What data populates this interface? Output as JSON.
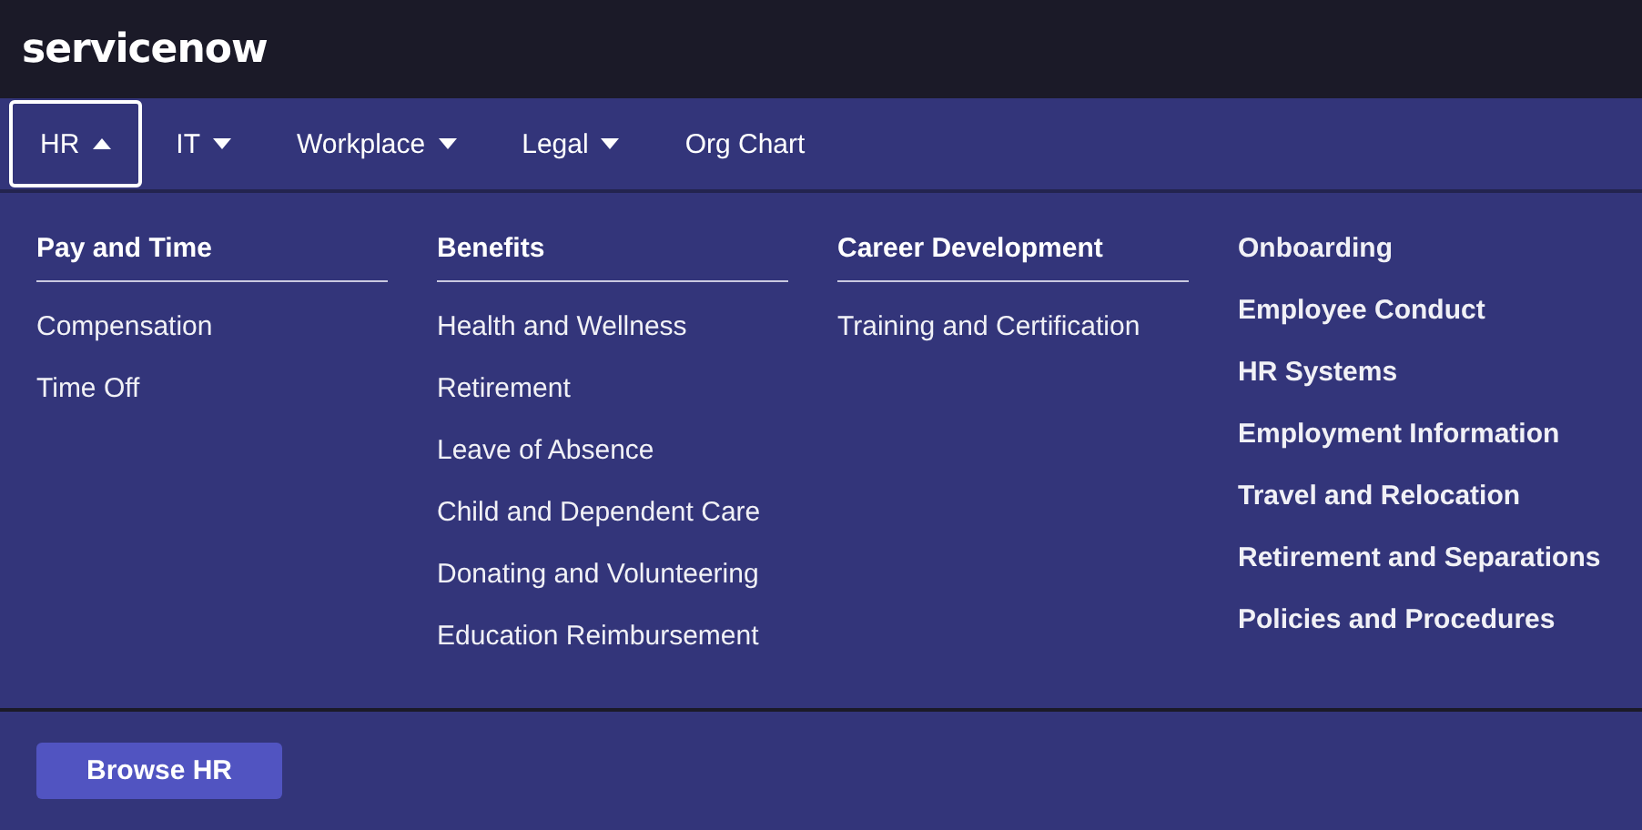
{
  "header": {
    "logo": "servicenow"
  },
  "nav": [
    {
      "label": "HR",
      "kind": "dropdown",
      "expanded": true
    },
    {
      "label": "IT",
      "kind": "dropdown",
      "expanded": false
    },
    {
      "label": "Workplace",
      "kind": "dropdown",
      "expanded": false
    },
    {
      "label": "Legal",
      "kind": "dropdown",
      "expanded": false
    },
    {
      "label": "Org Chart",
      "kind": "link",
      "expanded": false
    }
  ],
  "menu": {
    "columns": [
      {
        "kind": "group",
        "heading": "Pay and Time",
        "items": [
          "Compensation",
          "Time Off"
        ]
      },
      {
        "kind": "group",
        "heading": "Benefits",
        "items": [
          "Health and Wellness",
          "Retirement",
          "Leave of Absence",
          "Child and Dependent Care",
          "Donating and Volunteering",
          "Education Reimbursement"
        ]
      },
      {
        "kind": "group",
        "heading": "Career Development",
        "items": [
          "Training and Certification"
        ]
      },
      {
        "kind": "links",
        "items": [
          "Onboarding",
          "Employee Conduct",
          "HR Systems",
          "Employment Information",
          "Travel and Relocation",
          "Retirement and Separations",
          "Policies and Procedures"
        ]
      }
    ],
    "button": "Browse HR"
  }
}
